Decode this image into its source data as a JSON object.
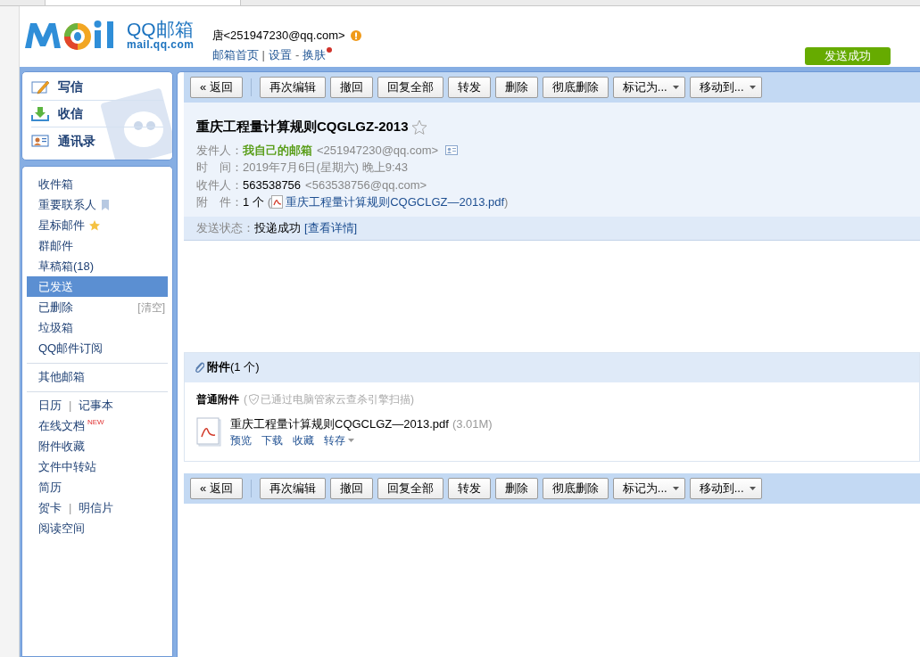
{
  "header": {
    "logo_title": "QQ邮箱",
    "logo_domain": "mail.qq.com",
    "account": "唐<251947230@qq.com>",
    "links": [
      "邮箱首页",
      "设置",
      "换肤"
    ],
    "separators": [
      "|",
      "-"
    ],
    "notice": "发送成功"
  },
  "quick_actions": [
    {
      "label": "写信",
      "kind": "compose"
    },
    {
      "label": "收信",
      "kind": "inbox"
    },
    {
      "label": "通讯录",
      "kind": "contacts"
    }
  ],
  "folder_groups": [
    [
      {
        "label": "收件箱",
        "selected": false
      },
      {
        "label": "重要联系人",
        "selected": false,
        "kind": "bookmarked"
      },
      {
        "label": "星标邮件",
        "selected": false,
        "kind": "starred"
      },
      {
        "label": "群邮件",
        "selected": false
      },
      {
        "label": "草稿箱(18)",
        "selected": false
      },
      {
        "label": "已发送",
        "selected": true
      },
      {
        "label": "已删除",
        "selected": false,
        "action": "[清空]"
      },
      {
        "label": "垃圾箱",
        "selected": false
      },
      {
        "label": "QQ邮件订阅",
        "selected": false
      }
    ],
    [
      {
        "label": "其他邮箱",
        "selected": false
      }
    ],
    [
      {
        "label": "日历",
        "selected": false,
        "separator": "|",
        "second": "记事本"
      },
      {
        "label": "在线文档",
        "selected": false,
        "badge": "NEW"
      },
      {
        "label": "附件收藏",
        "selected": false
      },
      {
        "label": "文件中转站",
        "selected": false
      },
      {
        "label": "简历",
        "selected": false
      },
      {
        "label": "贺卡",
        "selected": false,
        "separator": "|",
        "second": "明信片"
      },
      {
        "label": "阅读空间",
        "selected": false
      }
    ]
  ],
  "toolbar_top": [
    {
      "label": "« 返回",
      "kind": "back"
    },
    {
      "label": "再次编辑",
      "kind": "button"
    },
    {
      "label": "撤回",
      "kind": "button"
    },
    {
      "label": "回复全部",
      "kind": "button"
    },
    {
      "label": "转发",
      "kind": "button"
    },
    {
      "label": "删除",
      "kind": "button"
    },
    {
      "label": "彻底删除",
      "kind": "button"
    },
    {
      "label": "标记为...",
      "kind": "dropdown"
    },
    {
      "label": "移动到...",
      "kind": "dropdown"
    }
  ],
  "mail": {
    "subject": "重庆工程量计算规则CQGLGZ-2013",
    "starred": false,
    "fields": [
      {
        "kind": "sender",
        "label": "发件人：",
        "name": "我自己的邮箱",
        "address": "<251947230@qq.com>"
      },
      {
        "kind": "time",
        "label": "时　间：",
        "value": "2019年7月6日(星期六) 晚上9:43"
      },
      {
        "kind": "recipient",
        "label": "收件人：",
        "name": "563538756",
        "address": "<563538756@qq.com>"
      },
      {
        "kind": "attachment",
        "label": "附　件：",
        "value": "1 个",
        "open": "(",
        "file": "重庆工程量计算规则CQGCLGZ—2013.pdf",
        "close": ")"
      }
    ],
    "status": {
      "label": "发送状态：",
      "value": "投递成功",
      "link": "[查看详情]"
    }
  },
  "attachments": {
    "title": "附件",
    "count": "(1 个)",
    "group_label": "普通附件",
    "scan_open": "(",
    "scan_note": "已通过电脑管家云查杀引擎扫描)",
    "files": [
      {
        "name": "重庆工程量计算规则CQGCLGZ—2013.pdf",
        "size": "(3.01M)",
        "actions": [
          {
            "label": "预览",
            "dropdown": false
          },
          {
            "label": "下载",
            "dropdown": false
          },
          {
            "label": "收藏",
            "dropdown": false
          },
          {
            "label": "转存",
            "dropdown": true
          }
        ]
      }
    ]
  },
  "toolbar_bottom": [
    {
      "label": "« 返回",
      "kind": "back"
    },
    {
      "label": "再次编辑",
      "kind": "button"
    },
    {
      "label": "撤回",
      "kind": "button"
    },
    {
      "label": "回复全部",
      "kind": "button"
    },
    {
      "label": "转发",
      "kind": "button"
    },
    {
      "label": "删除",
      "kind": "button"
    },
    {
      "label": "彻底删除",
      "kind": "button"
    },
    {
      "label": "标记为...",
      "kind": "dropdown"
    },
    {
      "label": "移动到...",
      "kind": "dropdown"
    }
  ]
}
